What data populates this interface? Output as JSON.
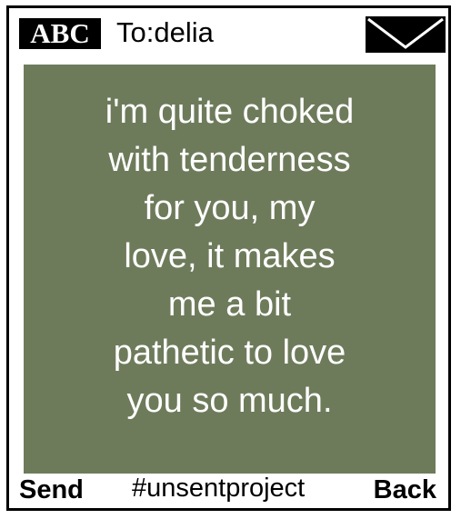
{
  "header": {
    "badge_label": "ABC",
    "recipient": "To:delia",
    "message_icon": "envelope-icon"
  },
  "message": {
    "text": "i'm quite choked\nwith tenderness\nfor you, my\nlove, it makes\nme a bit\npathetic to love\nyou so much."
  },
  "softkeys": {
    "left_label": "Send",
    "center_label": "#unsentproject",
    "right_label": "Back"
  },
  "colors": {
    "screen": "#6e7b5b",
    "text_on_screen": "#ffffff",
    "frame": "#000000"
  }
}
